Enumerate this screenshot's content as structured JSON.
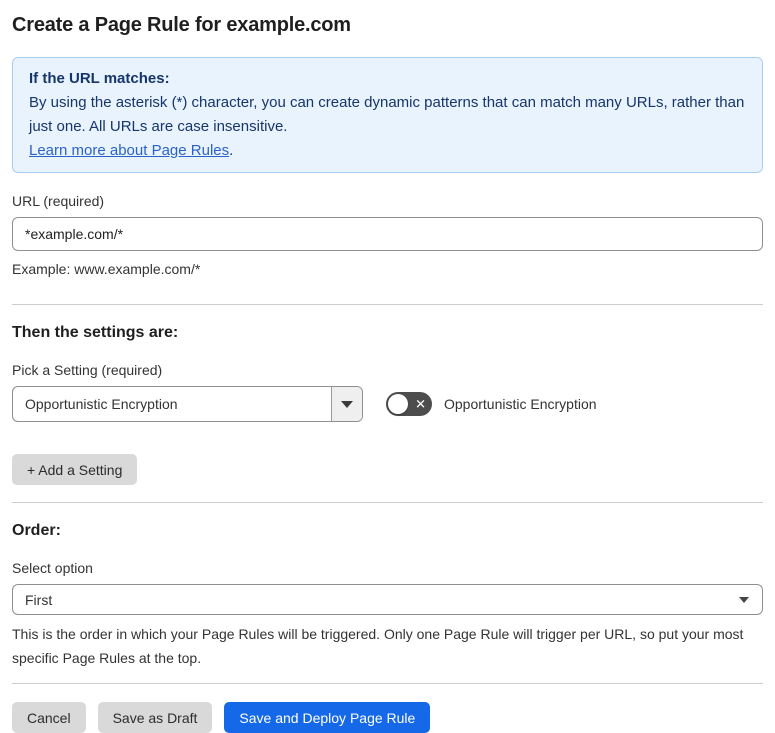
{
  "header": {
    "title": "Create a Page Rule for example.com"
  },
  "info_box": {
    "heading": "If the URL matches:",
    "body": "By using the asterisk (*) character, you can create dynamic patterns that can match many URLs, rather than just one. All URLs are case insensitive.",
    "link_label": "Learn more about Page Rules",
    "link_suffix": "."
  },
  "url_field": {
    "label": "URL (required)",
    "value": "*example.com/*",
    "example": "Example: www.example.com/*"
  },
  "settings_section": {
    "heading": "Then the settings are:",
    "picker_label": "Pick a Setting (required)",
    "selected_setting": "Opportunistic Encryption",
    "toggle": {
      "state": "off",
      "off_glyph": "✕",
      "label": "Opportunistic Encryption"
    },
    "add_button_label": "+ Add a Setting"
  },
  "order_section": {
    "heading": "Order:",
    "select_label": "Select option",
    "selected_option": "First",
    "help_text": "This is the order in which your Page Rules will be triggered. Only one Page Rule will trigger per URL, so put your most specific Page Rules at the top."
  },
  "footer": {
    "cancel_label": "Cancel",
    "save_draft_label": "Save as Draft",
    "save_deploy_label": "Save and Deploy Page Rule"
  },
  "colors": {
    "primary_button_blue": "#1568e8",
    "info_box_background": "#e9f3fd",
    "info_box_border": "#a9cdf1",
    "info_box_text": "#16356b",
    "link_blue": "#2b62c9",
    "toggle_off_background": "#4d4d4d",
    "gray_button": "#d9d9d9"
  }
}
